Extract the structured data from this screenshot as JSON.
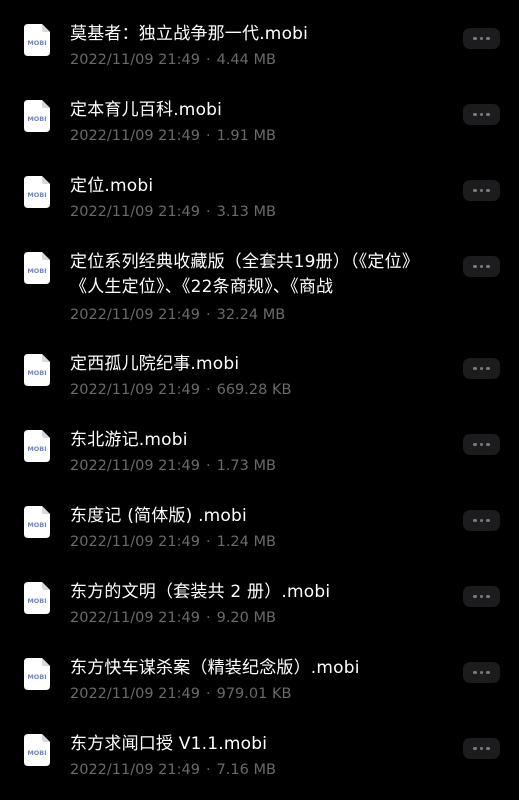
{
  "files": [
    {
      "name": "莫基者：独立战争那一代.mobi",
      "date": "2022/11/09 21:49",
      "size": "4.44 MB",
      "icon": "mobi-file-icon",
      "icon_label": "MOBI"
    },
    {
      "name": "定本育儿百科.mobi",
      "date": "2022/11/09 21:49",
      "size": "1.91 MB",
      "icon": "mobi-file-icon",
      "icon_label": "MOBI"
    },
    {
      "name": "定位.mobi",
      "date": "2022/11/09 21:49",
      "size": "3.13 MB",
      "icon": "mobi-file-icon",
      "icon_label": "MOBI"
    },
    {
      "name": "定位系列经典收藏版（全套共19册）（《定位》《人生定位》、《22条商规》、《商战",
      "date": "2022/11/09 21:49",
      "size": "32.24 MB",
      "icon": "mobi-file-icon",
      "icon_label": "MOBI"
    },
    {
      "name": "定西孤儿院纪事.mobi",
      "date": "2022/11/09 21:49",
      "size": "669.28 KB",
      "icon": "mobi-file-icon",
      "icon_label": "MOBI"
    },
    {
      "name": "东北游记.mobi",
      "date": "2022/11/09 21:49",
      "size": "1.73 MB",
      "icon": "mobi-file-icon",
      "icon_label": "MOBI"
    },
    {
      "name": "东度记 (简体版) .mobi",
      "date": "2022/11/09 21:49",
      "size": "1.24 MB",
      "icon": "mobi-file-icon",
      "icon_label": "MOBI"
    },
    {
      "name": "东方的文明（套装共 2 册）.mobi",
      "date": "2022/11/09 21:49",
      "size": "9.20 MB",
      "icon": "mobi-file-icon",
      "icon_label": "MOBI"
    },
    {
      "name": "东方快车谋杀案（精装纪念版）.mobi",
      "date": "2022/11/09 21:49",
      "size": "979.01 KB",
      "icon": "mobi-file-icon",
      "icon_label": "MOBI"
    },
    {
      "name": "东方求闻口授 V1.1.mobi",
      "date": "2022/11/09 21:49",
      "size": "7.16 MB",
      "icon": "mobi-file-icon",
      "icon_label": "MOBI"
    }
  ],
  "meta_separator": "·",
  "more_button_icon": "more-horizontal-icon",
  "colors": {
    "background": "#000000",
    "name_text": "#ffffff",
    "meta_text": "#6a6a6d",
    "icon_label": "#6f86c6",
    "button_bg": "#1c1c1f"
  }
}
